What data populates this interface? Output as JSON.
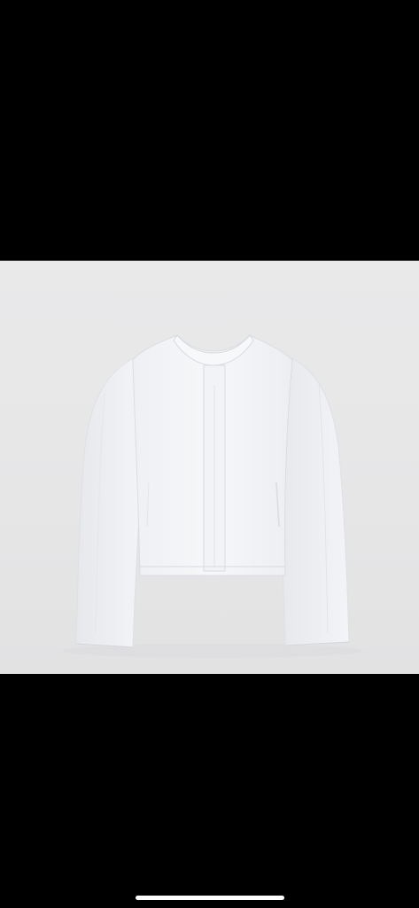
{
  "photo": {
    "subject": "cropped-white-jacket",
    "background_color": "#e8e8e9",
    "garment_color": "#f4f5f7"
  },
  "screen": {
    "background_color": "#000000",
    "home_indicator_color": "#ffffff"
  }
}
